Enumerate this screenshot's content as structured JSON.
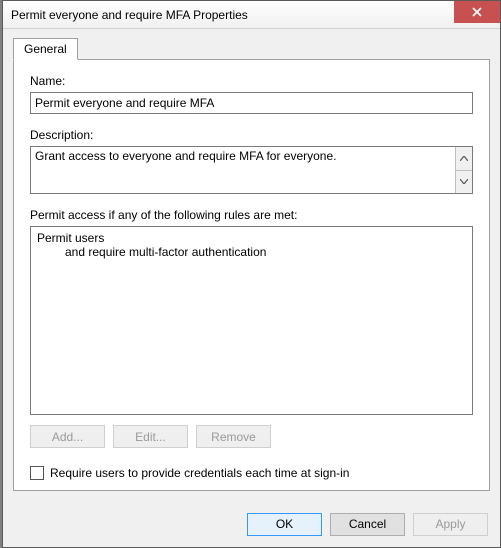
{
  "window": {
    "title": "Permit everyone and require MFA Properties"
  },
  "tabs": {
    "general": "General"
  },
  "fields": {
    "name_label": "Name:",
    "name_value": "Permit everyone and require MFA",
    "description_label": "Description:",
    "description_value": "Grant access to everyone and require MFA for everyone.",
    "rules_label": "Permit access if any of the following rules are met:"
  },
  "rules": {
    "line1": "Permit users",
    "line2": "and require multi-factor authentication"
  },
  "buttons": {
    "add": "Add...",
    "edit": "Edit...",
    "remove": "Remove",
    "ok": "OK",
    "cancel": "Cancel",
    "apply": "Apply"
  },
  "checkbox": {
    "require_credentials": "Require users to provide credentials each time at sign-in"
  }
}
